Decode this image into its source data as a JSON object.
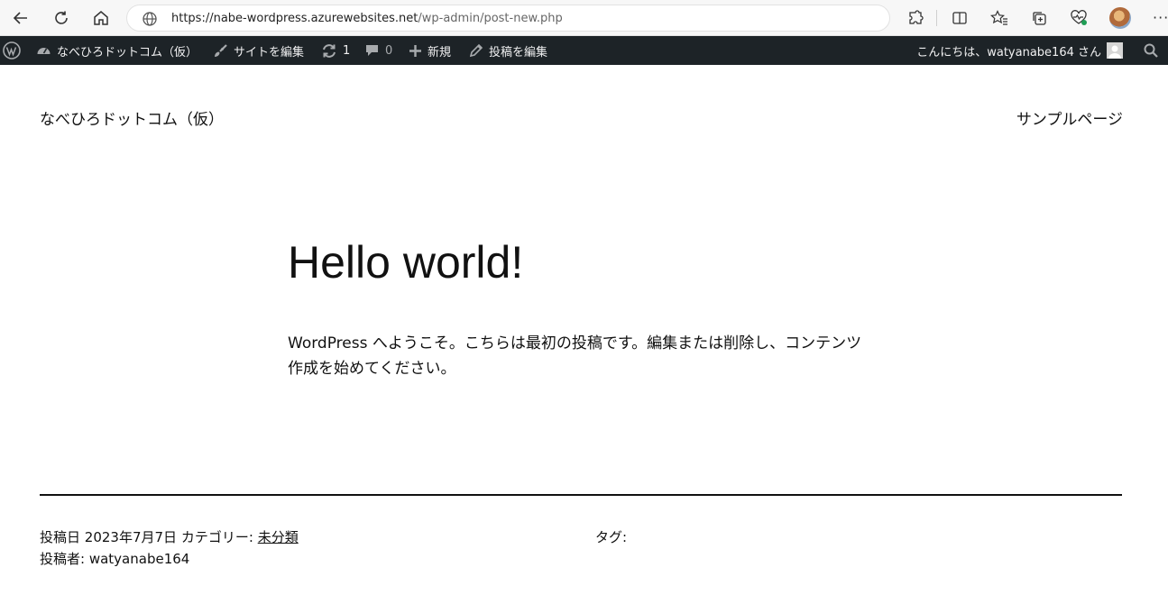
{
  "browser": {
    "url_host": "https://nabe-wordpress.azurewebsites.net",
    "url_path": "/wp-admin/post-new.php",
    "icons": [
      "back-arrow-icon",
      "refresh-icon",
      "home-icon",
      "globe-icon",
      "extensions-icon",
      "split-screen-icon",
      "favorites-icon",
      "collections-icon",
      "browser-health-icon",
      "profile-avatar",
      "more-menu-icon"
    ],
    "more_label": "···"
  },
  "admin_bar": {
    "site_name": "なべひろドットコム（仮）",
    "edit_site": "サイトを編集",
    "updates_count": "1",
    "comments_count": "0",
    "new_label": "新規",
    "edit_post": "投稿を編集",
    "greeting": "こんにちは、watyanabe164 さん",
    "colors": {
      "background": "#1d2327",
      "text": "#f0f0f1",
      "icon": "#a7aaad"
    }
  },
  "site": {
    "title": "なべひろドットコム（仮）",
    "nav_item": "サンプルページ"
  },
  "post": {
    "title": "Hello world!",
    "content": "WordPress へようこそ。こちらは最初の投稿です。編集または削除し、コンテンツ作成を始めてください。",
    "date_label": "投稿日",
    "date": "2023年7月7日",
    "category_label": "カテゴリー:",
    "category": "未分類",
    "author_label": "投稿者:",
    "author": "watyanabe164",
    "tags_label": "タグ:"
  }
}
